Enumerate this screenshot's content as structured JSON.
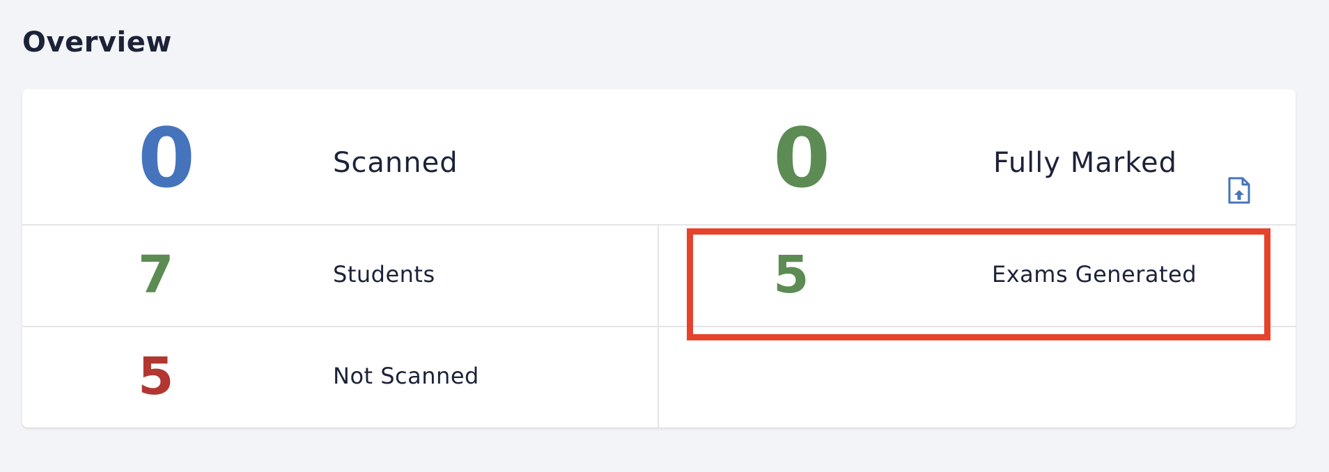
{
  "page": {
    "title": "Overview"
  },
  "stats": {
    "scanned": {
      "value": "0",
      "label": "Scanned",
      "color": "#4574bd"
    },
    "fully_marked": {
      "value": "0",
      "label": "Fully Marked",
      "color": "#5c8c53"
    },
    "students": {
      "value": "7",
      "label": "Students",
      "color": "#5c8c53"
    },
    "exams_generated": {
      "value": "5",
      "label": "Exams Generated",
      "color": "#5c8c53"
    },
    "not_scanned": {
      "value": "5",
      "label": "Not Scanned",
      "color": "#b23732"
    }
  },
  "icons": {
    "upload": "file-upload-icon"
  },
  "annotation": {
    "highlight_color": "#e5432c"
  }
}
